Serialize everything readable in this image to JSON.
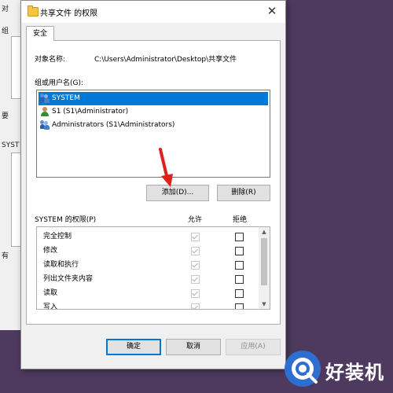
{
  "background_window": {
    "fragments": [
      "对",
      "组",
      "要",
      "SYST",
      "有"
    ]
  },
  "dialog": {
    "title": "共享文件 的权限",
    "close_glyph": "✕",
    "tab_label": "安全",
    "object_name_label": "对象名称:",
    "object_name_value": "C:\\Users\\Administrator\\Desktop\\共享文件",
    "group_label": "组或用户名(G):",
    "users": [
      {
        "name": "SYSTEM",
        "icon": "group-icon",
        "selected": true
      },
      {
        "name": "S1 (S1\\Administrator)",
        "icon": "user-icon",
        "selected": false
      },
      {
        "name": "Administrators (S1\\Administrators)",
        "icon": "group-icon",
        "selected": false
      }
    ],
    "add_button": "添加(D)...",
    "remove_button": "删除(R)",
    "permissions_label": "SYSTEM 的权限(P)",
    "allow_header": "允许",
    "deny_header": "拒绝",
    "permissions": [
      {
        "name": "完全控制",
        "allow": true,
        "deny": false
      },
      {
        "name": "修改",
        "allow": true,
        "deny": false
      },
      {
        "name": "读取和执行",
        "allow": true,
        "deny": false
      },
      {
        "name": "列出文件夹内容",
        "allow": true,
        "deny": false
      },
      {
        "name": "读取",
        "allow": true,
        "deny": false
      },
      {
        "name": "写入",
        "allow": true,
        "deny": false
      }
    ],
    "ok_button": "确定",
    "cancel_button": "取消",
    "apply_button": "应用(A)"
  },
  "watermark": {
    "text": "好装机"
  },
  "colors": {
    "selection": "#0078d7",
    "annotation_arrow": "#e0201b",
    "desktop": "#4d3a5e"
  }
}
